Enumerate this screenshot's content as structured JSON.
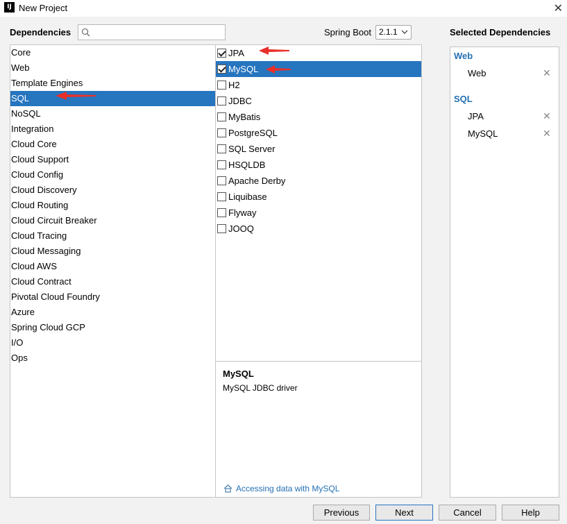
{
  "window": {
    "title": "New Project",
    "app_icon": "IJ"
  },
  "header": {
    "dependencies_label": "Dependencies",
    "search": {
      "value": "",
      "placeholder": ""
    },
    "spring_boot_label": "Spring Boot",
    "spring_boot_version": "2.1.1",
    "selected_dependencies_label": "Selected Dependencies"
  },
  "categories": [
    "Core",
    "Web",
    "Template Engines",
    "SQL",
    "NoSQL",
    "Integration",
    "Cloud Core",
    "Cloud Support",
    "Cloud Config",
    "Cloud Discovery",
    "Cloud Routing",
    "Cloud Circuit Breaker",
    "Cloud Tracing",
    "Cloud Messaging",
    "Cloud AWS",
    "Cloud Contract",
    "Pivotal Cloud Foundry",
    "Azure",
    "Spring Cloud GCP",
    "I/O",
    "Ops"
  ],
  "selected_category_index": 3,
  "dependencies": [
    {
      "label": "JPA",
      "checked": true
    },
    {
      "label": "MySQL",
      "checked": true
    },
    {
      "label": "H2",
      "checked": false
    },
    {
      "label": "JDBC",
      "checked": false
    },
    {
      "label": "MyBatis",
      "checked": false
    },
    {
      "label": "PostgreSQL",
      "checked": false
    },
    {
      "label": "SQL Server",
      "checked": false
    },
    {
      "label": "HSQLDB",
      "checked": false
    },
    {
      "label": "Apache Derby",
      "checked": false
    },
    {
      "label": "Liquibase",
      "checked": false
    },
    {
      "label": "Flyway",
      "checked": false
    },
    {
      "label": "JOOQ",
      "checked": false
    }
  ],
  "selected_dependency_index": 1,
  "description": {
    "title": "MySQL",
    "text": "MySQL JDBC driver",
    "link": "Accessing data with MySQL"
  },
  "selected": [
    {
      "group": "Web",
      "items": [
        "Web"
      ]
    },
    {
      "group": "SQL",
      "items": [
        "JPA",
        "MySQL"
      ]
    }
  ],
  "buttons": {
    "previous": "Previous",
    "next": "Next",
    "cancel": "Cancel",
    "help": "Help"
  },
  "colors": {
    "selection": "#2675bf",
    "link": "#2470b3",
    "annotation_arrow": "#e8302a"
  },
  "icons": {
    "search": "search-icon",
    "close": "close-icon",
    "remove": "remove-icon",
    "guide": "home-icon",
    "arrow": "red-arrow-icon"
  }
}
